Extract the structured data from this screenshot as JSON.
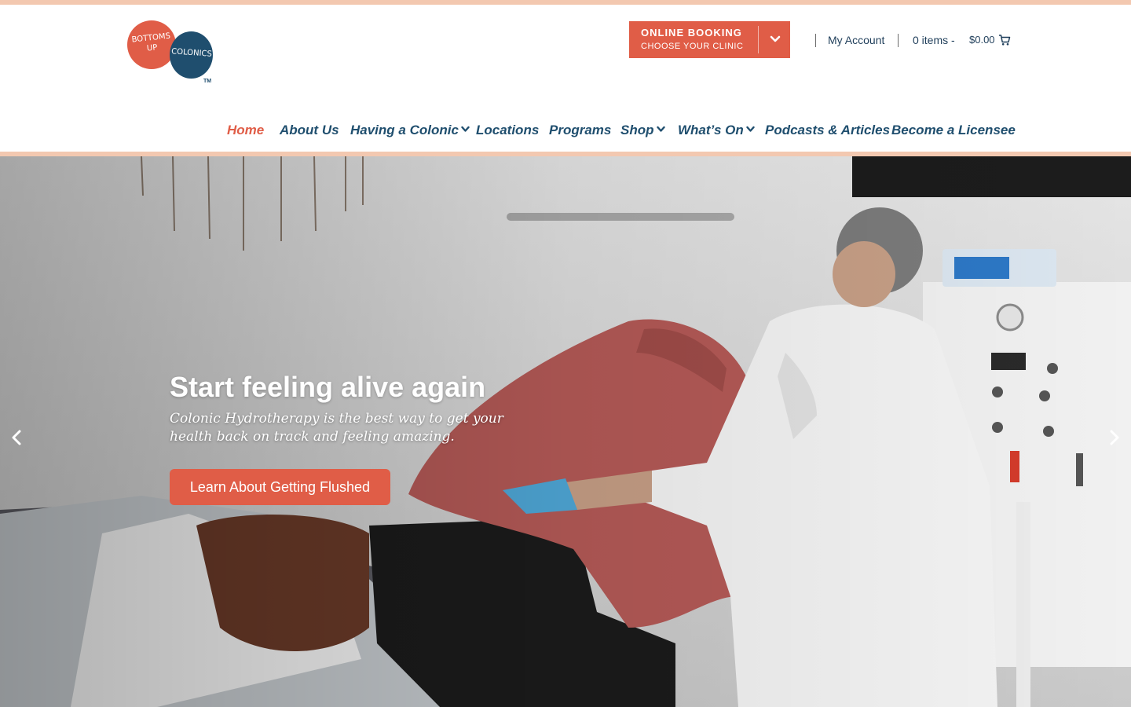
{
  "logo": {
    "line1": "BOTTOMS",
    "line2": "UP",
    "line3": "COLONICS",
    "tm": "TM"
  },
  "booking": {
    "title": "ONLINE BOOKING",
    "subtitle": "CHOOSE YOUR CLINIC"
  },
  "account": {
    "label": "My Account",
    "items": "0 items -",
    "total": "$0.00"
  },
  "nav": {
    "home": "Home",
    "about": "About Us",
    "colonic": "Having a Colonic",
    "locations": "Locations",
    "programs": "Programs",
    "shop": "Shop",
    "whatson": "What’s On",
    "podcasts": "Podcasts & Articles",
    "licensee": "Become a Licensee"
  },
  "hero": {
    "title": "Start feeling alive again",
    "subtitle": "Colonic Hydrotherapy is the best way to get your health back on track and feeling amazing.",
    "button": "Learn About Getting Flushed"
  },
  "colors": {
    "accent": "#e05d47",
    "navy": "#1f4e6e",
    "stripe": "#f3c8b0"
  },
  "icons": [
    "chevron-down-icon",
    "cart-icon",
    "chevron-left-icon",
    "chevron-right-icon"
  ]
}
